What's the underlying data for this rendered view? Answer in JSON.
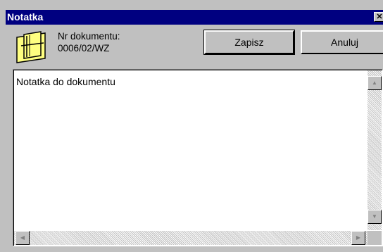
{
  "window": {
    "title": "Notatka",
    "close_glyph": "✕"
  },
  "document": {
    "number_label": "Nr dokumentu:",
    "number_value": "0006/02/WZ",
    "icon": "notepad-icon"
  },
  "buttons": {
    "save_label": "Zapisz",
    "cancel_label": "Anuluj"
  },
  "note": {
    "text": "Notatka do dokumentu"
  },
  "scrollbars": {
    "up_glyph": "▲",
    "down_glyph": "▼",
    "left_glyph": "◀",
    "right_glyph": "▶"
  }
}
